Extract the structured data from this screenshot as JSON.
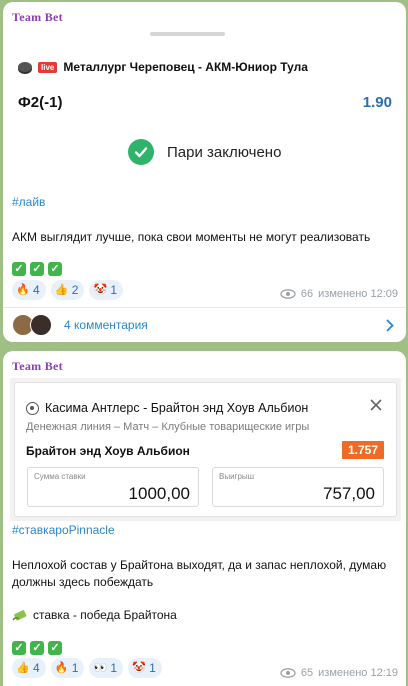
{
  "post1": {
    "channel": "Team Bet",
    "live_badge": "live",
    "match": "Металлург Череповец - АКМ-Юниор Тула",
    "market": "Ф2(-1)",
    "odds": "1.90",
    "confirm_text": "Пари заключено",
    "hashtag": "#лайв",
    "text": "АКМ выглядит лучше, пока свои моменты не могут реализовать",
    "checks_count": 3,
    "reactions": [
      {
        "icon": "fire-emoji",
        "glyph": "🔥",
        "count": "4"
      },
      {
        "icon": "thumbs-up-emoji",
        "glyph": "👍",
        "count": "2"
      },
      {
        "icon": "clown-emoji",
        "glyph": "🤡",
        "count": "1"
      }
    ],
    "views": "66",
    "edited": "изменено 12:09",
    "comments": "4 комментария"
  },
  "post2": {
    "channel": "Team Bet",
    "screenshot": {
      "match": "Касима Антлерс - Брайтон энд Хоув Альбион",
      "subtitle": "Денежная линия – Матч – Клубные товарищеские игры",
      "pick": "Брайтон энд Хоув Альбион",
      "odds": "1.757",
      "stake_label": "Сумма ставки",
      "stake_value": "1000,00",
      "win_label": "Выигрыш",
      "win_value": "757,00"
    },
    "hashtag": "#ставкаpоPinnacle",
    "text": "Неплохой состав у Брайтона выходят, да и запас неплохой, думаю должны здесь побеждать",
    "bet_line": "ставка - победа Брайтона",
    "checks_count": 3,
    "reactions": [
      {
        "icon": "thumbs-up-emoji",
        "glyph": "👍",
        "count": "4"
      },
      {
        "icon": "fire-emoji",
        "glyph": "🔥",
        "count": "1"
      },
      {
        "icon": "eyes-emoji",
        "glyph": "👀",
        "count": "1"
      },
      {
        "icon": "clown-emoji",
        "glyph": "🤡",
        "count": "1"
      }
    ],
    "views": "65",
    "edited": "изменено 12:19"
  },
  "colors": {
    "background": "#9fbf84",
    "link": "#2b87c8",
    "channel": "#8a3fb5",
    "success": "#2fb36b",
    "odds_badge": "#ef6a22"
  }
}
